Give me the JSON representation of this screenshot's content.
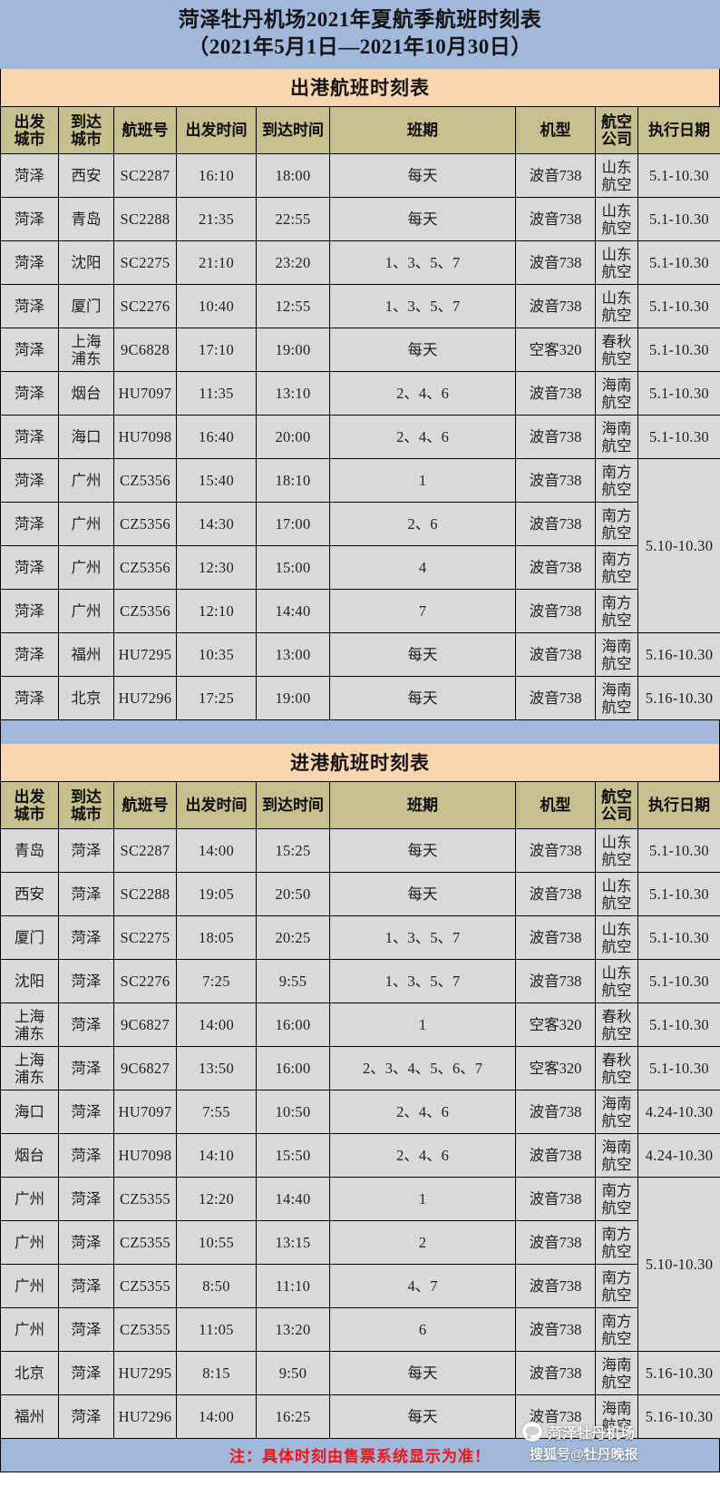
{
  "title": {
    "line1": "菏泽牡丹机场2021年夏航季航班时刻表",
    "line2": "（2021年5月1日—2021年10月30日）"
  },
  "columns": {
    "departure_city": "出发\n城市",
    "departure_city_l1": "出发",
    "departure_city_l2": "城市",
    "arrival_city_l1": "到达",
    "arrival_city_l2": "城市",
    "flight_no": "航班号",
    "departure_time": "出发时间",
    "arrival_time": "到达时间",
    "frequency": "班期",
    "aircraft": "机型",
    "airline_l1": "航空",
    "airline_l2": "公司",
    "effective_date": "执行日期"
  },
  "departures": {
    "section_title": "出港航班时刻表",
    "rows": [
      {
        "from": "菏泽",
        "to": "西安",
        "to2": "",
        "flight": "SC2287",
        "dep": "16:10",
        "arr": "18:00",
        "days": "每天",
        "aircraft": "波音738",
        "airline_l1": "山东",
        "airline_l2": "航空",
        "date": "5.1-10.30",
        "date_span": 1
      },
      {
        "from": "菏泽",
        "to": "青岛",
        "to2": "",
        "flight": "SC2288",
        "dep": "21:35",
        "arr": "22:55",
        "days": "每天",
        "aircraft": "波音738",
        "airline_l1": "山东",
        "airline_l2": "航空",
        "date": "5.1-10.30",
        "date_span": 1
      },
      {
        "from": "菏泽",
        "to": "沈阳",
        "to2": "",
        "flight": "SC2275",
        "dep": "21:10",
        "arr": "23:20",
        "days": "1、3、5、7",
        "aircraft": "波音738",
        "airline_l1": "山东",
        "airline_l2": "航空",
        "date": "5.1-10.30",
        "date_span": 1
      },
      {
        "from": "菏泽",
        "to": "厦门",
        "to2": "",
        "flight": "SC2276",
        "dep": "10:40",
        "arr": "12:55",
        "days": "1、3、5、7",
        "aircraft": "波音738",
        "airline_l1": "山东",
        "airline_l2": "航空",
        "date": "5.1-10.30",
        "date_span": 1
      },
      {
        "from": "菏泽",
        "to": "上海",
        "to2": "浦东",
        "flight": "9C6828",
        "dep": "17:10",
        "arr": "19:00",
        "days": "每天",
        "aircraft": "空客320",
        "airline_l1": "春秋",
        "airline_l2": "航空",
        "date": "5.1-10.30",
        "date_span": 1
      },
      {
        "from": "菏泽",
        "to": "烟台",
        "to2": "",
        "flight": "HU7097",
        "dep": "11:35",
        "arr": "13:10",
        "days": "2、4、6",
        "aircraft": "波音738",
        "airline_l1": "海南",
        "airline_l2": "航空",
        "date": "5.1-10.30",
        "date_span": 1
      },
      {
        "from": "菏泽",
        "to": "海口",
        "to2": "",
        "flight": "HU7098",
        "dep": "16:40",
        "arr": "20:00",
        "days": "2、4、6",
        "aircraft": "波音738",
        "airline_l1": "海南",
        "airline_l2": "航空",
        "date": "5.1-10.30",
        "date_span": 1
      },
      {
        "from": "菏泽",
        "to": "广州",
        "to2": "",
        "flight": "CZ5356",
        "dep": "15:40",
        "arr": "18:10",
        "days": "1",
        "aircraft": "波音738",
        "airline_l1": "南方",
        "airline_l2": "航空",
        "date": "5.10-10.30",
        "date_span": 4
      },
      {
        "from": "菏泽",
        "to": "广州",
        "to2": "",
        "flight": "CZ5356",
        "dep": "14:30",
        "arr": "17:00",
        "days": "2、6",
        "aircraft": "波音738",
        "airline_l1": "南方",
        "airline_l2": "航空",
        "date": "",
        "date_span": 0
      },
      {
        "from": "菏泽",
        "to": "广州",
        "to2": "",
        "flight": "CZ5356",
        "dep": "12:30",
        "arr": "15:00",
        "days": "4",
        "aircraft": "波音738",
        "airline_l1": "南方",
        "airline_l2": "航空",
        "date": "",
        "date_span": 0
      },
      {
        "from": "菏泽",
        "to": "广州",
        "to2": "",
        "flight": "CZ5356",
        "dep": "12:10",
        "arr": "14:40",
        "days": "7",
        "aircraft": "波音738",
        "airline_l1": "南方",
        "airline_l2": "航空",
        "date": "",
        "date_span": 0
      },
      {
        "from": "菏泽",
        "to": "福州",
        "to2": "",
        "flight": "HU7295",
        "dep": "10:35",
        "arr": "13:00",
        "days": "每天",
        "aircraft": "波音738",
        "airline_l1": "海南",
        "airline_l2": "航空",
        "date": "5.16-10.30",
        "date_span": 1
      },
      {
        "from": "菏泽",
        "to": "北京",
        "to2": "",
        "flight": "HU7296",
        "dep": "17:25",
        "arr": "19:00",
        "days": "每天",
        "aircraft": "波音738",
        "airline_l1": "海南",
        "airline_l2": "航空",
        "date": "5.16-10.30",
        "date_span": 1
      }
    ]
  },
  "arrivals": {
    "section_title": "进港航班时刻表",
    "rows": [
      {
        "from": "青岛",
        "from2": "",
        "to": "菏泽",
        "flight": "SC2287",
        "dep": "14:00",
        "arr": "15:25",
        "days": "每天",
        "aircraft": "波音738",
        "airline_l1": "山东",
        "airline_l2": "航空",
        "date": "5.1-10.30",
        "date_span": 1
      },
      {
        "from": "西安",
        "from2": "",
        "to": "菏泽",
        "flight": "SC2288",
        "dep": "19:05",
        "arr": "20:50",
        "days": "每天",
        "aircraft": "波音738",
        "airline_l1": "山东",
        "airline_l2": "航空",
        "date": "5.1-10.30",
        "date_span": 1
      },
      {
        "from": "厦门",
        "from2": "",
        "to": "菏泽",
        "flight": "SC2275",
        "dep": "18:05",
        "arr": "20:25",
        "days": "1、3、5、7",
        "aircraft": "波音738",
        "airline_l1": "山东",
        "airline_l2": "航空",
        "date": "5.1-10.30",
        "date_span": 1
      },
      {
        "from": "沈阳",
        "from2": "",
        "to": "菏泽",
        "flight": "SC2276",
        "dep": "7:25",
        "arr": "9:55",
        "days": "1、3、5、7",
        "aircraft": "波音738",
        "airline_l1": "山东",
        "airline_l2": "航空",
        "date": "5.1-10.30",
        "date_span": 1
      },
      {
        "from": "上海",
        "from2": "浦东",
        "to": "菏泽",
        "flight": "9C6827",
        "dep": "14:00",
        "arr": "16:00",
        "days": "1",
        "aircraft": "空客320",
        "airline_l1": "春秋",
        "airline_l2": "航空",
        "date": "5.1-10.30",
        "date_span": 1
      },
      {
        "from": "上海",
        "from2": "浦东",
        "to": "菏泽",
        "flight": "9C6827",
        "dep": "13:50",
        "arr": "16:00",
        "days": "2、3、4、5、6、7",
        "aircraft": "空客320",
        "airline_l1": "春秋",
        "airline_l2": "航空",
        "date": "5.1-10.30",
        "date_span": 1
      },
      {
        "from": "海口",
        "from2": "",
        "to": "菏泽",
        "flight": "HU7097",
        "dep": "7:55",
        "arr": "10:50",
        "days": "2、4、6",
        "aircraft": "波音738",
        "airline_l1": "海南",
        "airline_l2": "航空",
        "date": "4.24-10.30",
        "date_span": 1
      },
      {
        "from": "烟台",
        "from2": "",
        "to": "菏泽",
        "flight": "HU7098",
        "dep": "14:10",
        "arr": "15:50",
        "days": "2、4、6",
        "aircraft": "波音738",
        "airline_l1": "海南",
        "airline_l2": "航空",
        "date": "4.24-10.30",
        "date_span": 1
      },
      {
        "from": "广州",
        "from2": "",
        "to": "菏泽",
        "flight": "CZ5355",
        "dep": "12:20",
        "arr": "14:40",
        "days": "1",
        "aircraft": "波音738",
        "airline_l1": "南方",
        "airline_l2": "航空",
        "date": "5.10-10.30",
        "date_span": 4
      },
      {
        "from": "广州",
        "from2": "",
        "to": "菏泽",
        "flight": "CZ5355",
        "dep": "10:55",
        "arr": "13:15",
        "days": "2",
        "aircraft": "波音738",
        "airline_l1": "南方",
        "airline_l2": "航空",
        "date": "",
        "date_span": 0
      },
      {
        "from": "广州",
        "from2": "",
        "to": "菏泽",
        "flight": "CZ5355",
        "dep": "8:50",
        "arr": "11:10",
        "days": "4、7",
        "aircraft": "波音738",
        "airline_l1": "南方",
        "airline_l2": "航空",
        "date": "",
        "date_span": 0
      },
      {
        "from": "广州",
        "from2": "",
        "to": "菏泽",
        "flight": "CZ5355",
        "dep": "11:05",
        "arr": "13:20",
        "days": "6",
        "aircraft": "波音738",
        "airline_l1": "南方",
        "airline_l2": "航空",
        "date": "",
        "date_span": 0
      },
      {
        "from": "北京",
        "from2": "",
        "to": "菏泽",
        "flight": "HU7295",
        "dep": "8:15",
        "arr": "9:50",
        "days": "每天",
        "aircraft": "波音738",
        "airline_l1": "海南",
        "airline_l2": "航空",
        "date": "5.16-10.30",
        "date_span": 1
      },
      {
        "from": "福州",
        "from2": "",
        "to": "菏泽",
        "flight": "HU7296",
        "dep": "14:00",
        "arr": "16:25",
        "days": "每天",
        "aircraft": "波音738",
        "airline_l1": "海南",
        "airline_l2": "航空",
        "date": "5.16-10.30",
        "date_span": 1
      }
    ]
  },
  "footer": {
    "note": "注：具体时刻由售票系统显示为准！"
  },
  "watermark": {
    "line1": "菏泽牡丹机场",
    "line2": "搜狐号@牡丹晚报"
  },
  "colors": {
    "banner_blue": "#9fb8dc",
    "section_peach": "#fad6b0",
    "header_khaki": "#c8bf8f",
    "cell_grey": "#d9d9d9",
    "note_red": "#f01414"
  }
}
